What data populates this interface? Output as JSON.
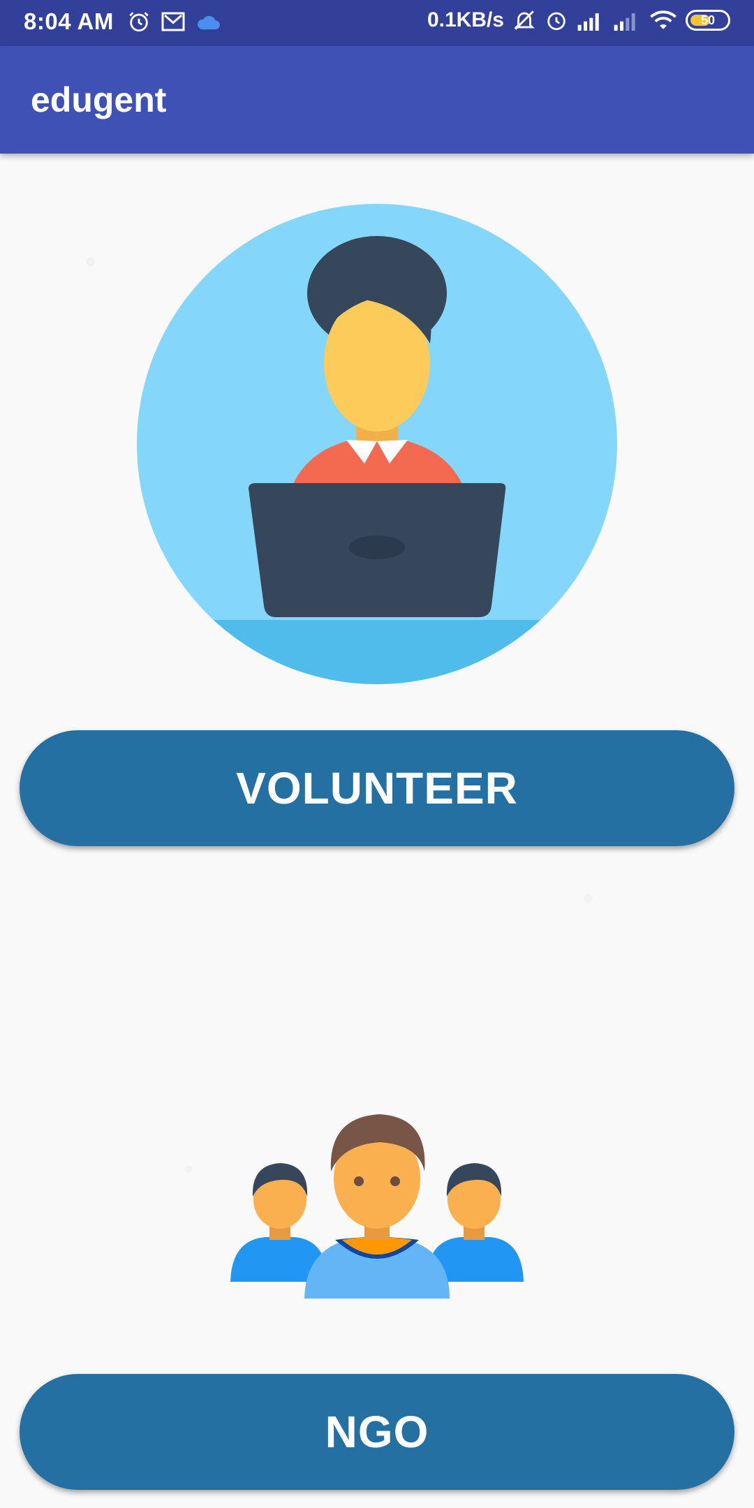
{
  "status_bar": {
    "time": "8:04 AM",
    "net_speed": "0.1KB/s",
    "battery": "50",
    "icons_left": [
      "alarm-icon",
      "mail-icon",
      "cloud-icon"
    ],
    "icons_right": [
      "mute-icon",
      "alarm-icon",
      "signal-icon",
      "signal-icon",
      "wifi-icon",
      "battery-icon"
    ]
  },
  "app_bar": {
    "title": "edugent",
    "color": "#3f51b5"
  },
  "main": {
    "volunteer_button": "VOLUNTEER",
    "ngo_button": "NGO",
    "button_color": "#2470a3"
  }
}
